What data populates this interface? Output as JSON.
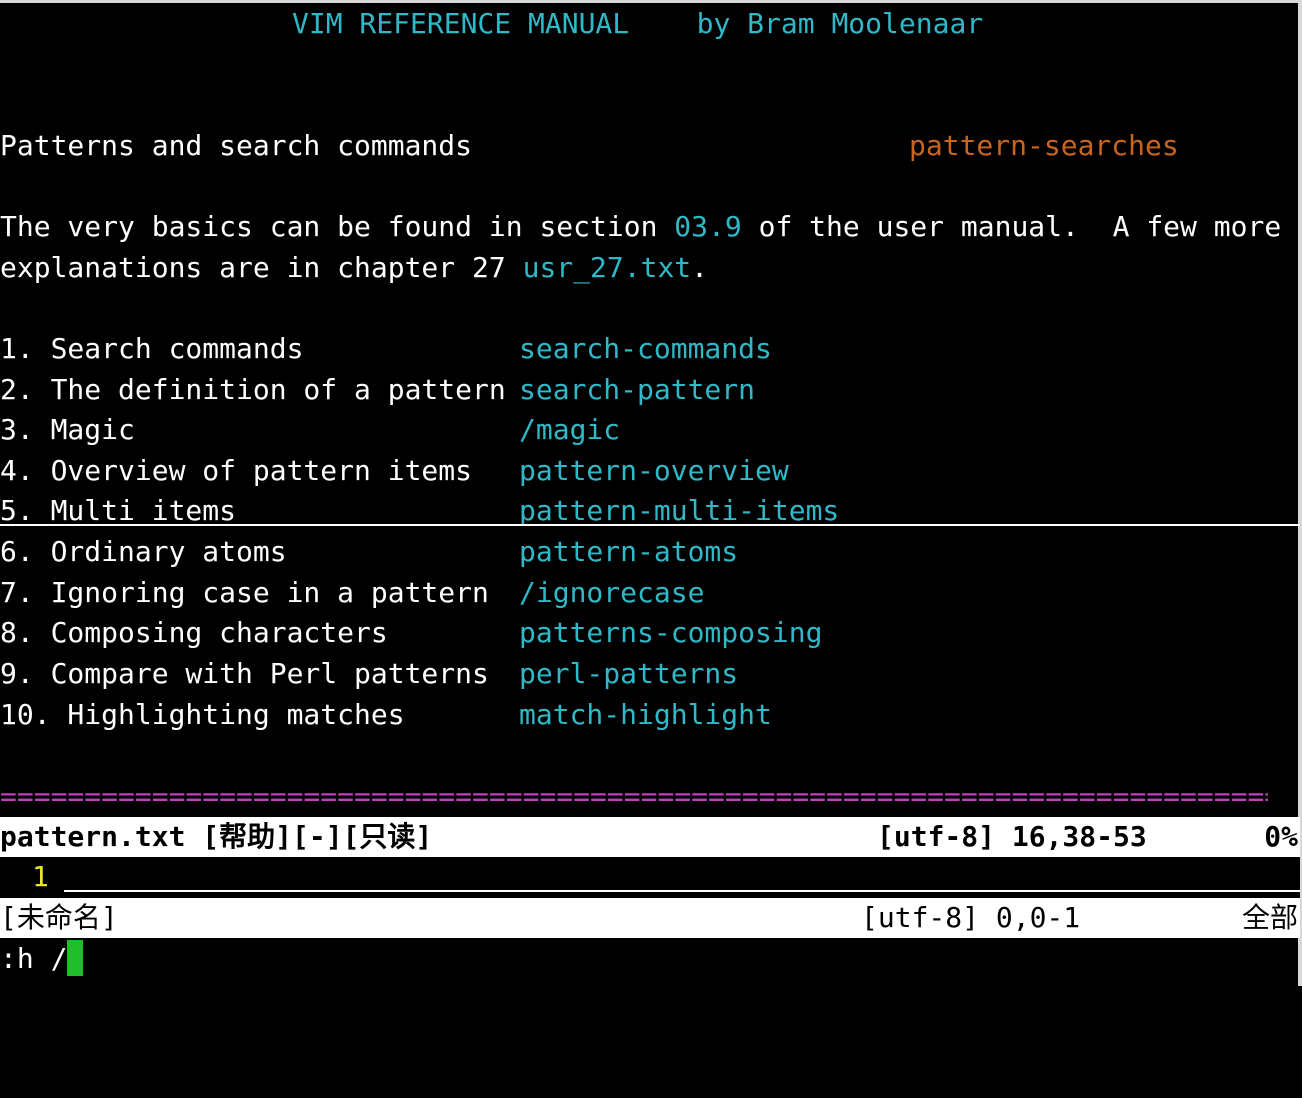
{
  "header": {
    "title": "VIM REFERENCE MANUAL",
    "author": "by Bram Moolenaar"
  },
  "heading": {
    "text": "Patterns and search commands",
    "tag": "pattern-searches"
  },
  "intro": {
    "line1_prefix": "The very basics can be found in section ",
    "line1_link": "03.9",
    "line1_suffix": " of the user manual.  A few more",
    "line2_prefix": "explanations are in chapter 27 ",
    "line2_link": "usr_27.txt",
    "line2_suffix": "."
  },
  "toc": [
    {
      "label": "1. Search commands",
      "link": "search-commands"
    },
    {
      "label": "2. The definition of a pattern",
      "link": "search-pattern"
    },
    {
      "label": "3. Magic",
      "link": "/magic"
    },
    {
      "label": "4. Overview of pattern items",
      "link": "pattern-overview"
    },
    {
      "label": "5. Multi items",
      "link": "pattern-multi-items"
    },
    {
      "label": "6. Ordinary atoms",
      "link": "pattern-atoms"
    },
    {
      "label": "7. Ignoring case in a pattern",
      "link": "/ignorecase"
    },
    {
      "label": "8. Composing characters",
      "link": "patterns-composing"
    },
    {
      "label": "9. Compare with Perl patterns",
      "link": "perl-patterns"
    },
    {
      "label": "10. Highlighting matches",
      "link": "match-highlight"
    }
  ],
  "separator": "==============================================================================",
  "status_help": {
    "filename": "pattern.txt [帮助][-][只读]",
    "encoding_pos": "[utf-8] 16,38-53",
    "percent": "0%"
  },
  "empty_buffer": {
    "line_number": "1"
  },
  "status_empty": {
    "filename": "[未命名]",
    "encoding_pos": "[utf-8] 0,0-1",
    "percent": "全部"
  },
  "cmdline": {
    "text": ":h /"
  },
  "colors": {
    "link": "#2fb8c8",
    "tag": "#c9641e",
    "line_number": "#e6e62a",
    "separator": "#c040c0",
    "cursor": "#1fbf2a"
  }
}
